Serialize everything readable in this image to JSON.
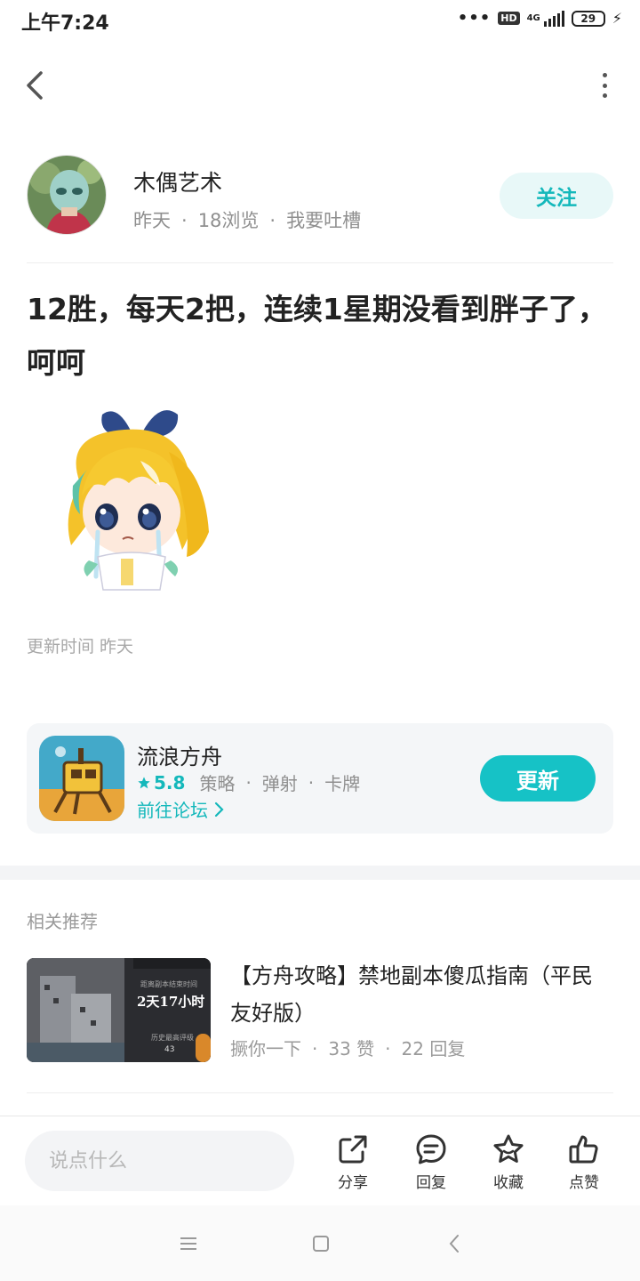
{
  "status_bar": {
    "time": "上午7:24",
    "hd": "HD",
    "network": "4G",
    "battery": "29"
  },
  "nav": {
    "back_icon": "chevron-left-icon",
    "more_icon": "vertical-dots-icon"
  },
  "author": {
    "name": "木偶艺术",
    "posted": "昨天",
    "views": "18浏览",
    "complain": "我要吐槽",
    "follow_label": "关注"
  },
  "post": {
    "title": "12胜，每天2把，连续1星期没看到胖子了，呵呵",
    "update_time": "更新时间 昨天"
  },
  "game": {
    "name": "流浪方舟",
    "rating": "5.8",
    "tags": [
      "策略",
      "弹射",
      "卡牌"
    ],
    "forum_link": "前往论坛",
    "update_label": "更新"
  },
  "recommend": {
    "section_title": "相关推荐",
    "items": [
      {
        "title": "【方舟攻略】禁地副本傻瓜指南（平民友好版）",
        "author": "撅你一下",
        "likes": "33 赞",
        "replies": "22 回复",
        "thumb_text": "2天17小时",
        "thumb_sub1": "距离副本结束时间",
        "thumb_sub2": "历史最高评级",
        "thumb_num": "43"
      }
    ]
  },
  "bottom_bar": {
    "input_placeholder": "说点什么",
    "share": "分享",
    "reply": "回复",
    "favorite": "收藏",
    "like": "点赞"
  },
  "colors": {
    "accent": "#16c2c6",
    "accent_light": "#e8f8f8",
    "text_muted": "#8f8f8f"
  }
}
